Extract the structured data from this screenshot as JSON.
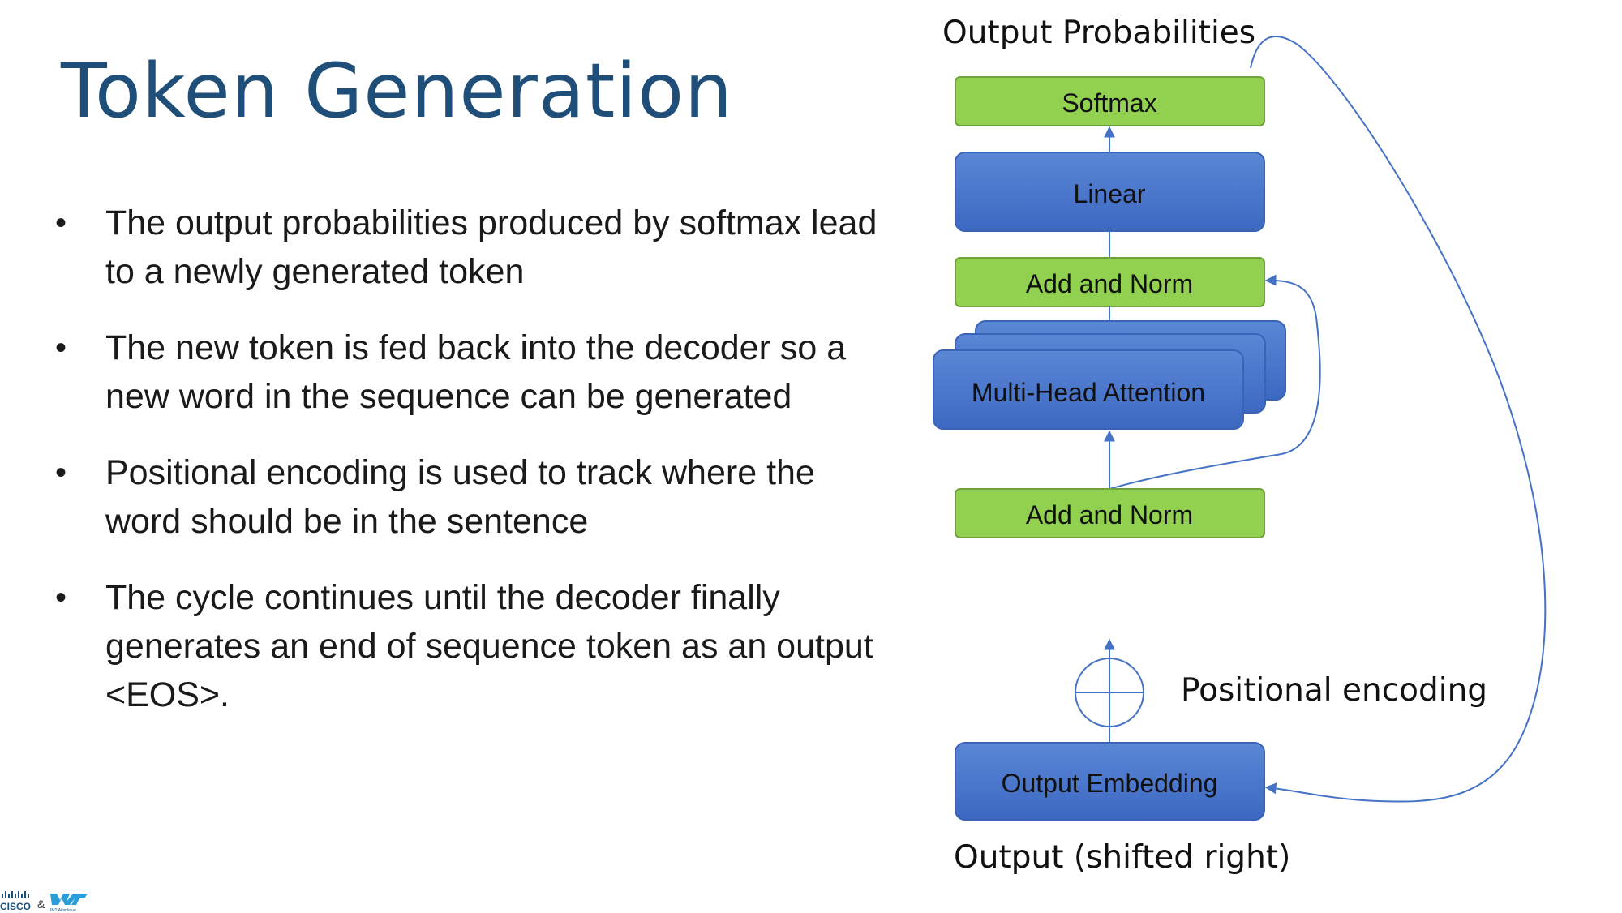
{
  "slide": {
    "title": "Token Generation",
    "bullets": [
      "The output probabilities produced by softmax lead to a newly generated token",
      "The new token is fed back into the decoder so a new word in the sequence can be generated",
      "Positional encoding is used to track where the word should be in the sentence",
      "The cycle continues until the decoder finally generates an end of sequence token as an output <EOS>."
    ],
    "bullet_glyph": "•"
  },
  "diagram": {
    "top_label": "Output Probabilities",
    "bottom_label": "Output (shifted right)",
    "positional_label": "Positional encoding",
    "blocks": {
      "softmax": "Softmax",
      "linear": "Linear",
      "add_norm_top": "Add and Norm",
      "mha": "Multi-Head Attention",
      "add_norm_bottom": "Add and Norm",
      "output_embedding": "Output Embedding"
    },
    "colors": {
      "green_block": "#92D050",
      "blue_block": "#4472C4",
      "arrow": "#4472C4"
    }
  },
  "footer": {
    "logo_left": "CISCO",
    "logo_amp": "&",
    "logo_right": "IMT Atlantique"
  }
}
